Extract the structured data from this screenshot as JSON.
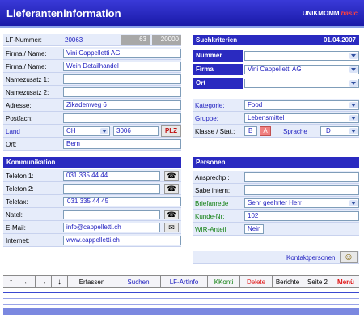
{
  "title": "Lieferanteninformation",
  "logo": {
    "main": "UNIKMOMM",
    "accent": "basic"
  },
  "left": {
    "lf_nummer_label": "LF-Nummer:",
    "lf_nummer": "20063",
    "lf_box1": "63",
    "lf_box2": "20000",
    "firma1_label": "Firma / Name:",
    "firma1": "Vini Cappelletti AG",
    "firma2_label": "Firma / Name:",
    "firma2": "Wein Detailhandel",
    "namezusatz1_label": "Namezusatz 1:",
    "namezusatz1": "",
    "namezusatz2_label": "Namezusatz 2:",
    "namezusatz2": "",
    "adresse_label": "Adresse:",
    "adresse": "Zikadenweg 6",
    "postfach_label": "Postfach:",
    "postfach": "",
    "land_label": "Land",
    "land": "CH",
    "plz": "3006",
    "plz_button": "PLZ",
    "ort_label": "Ort:",
    "ort": "Bern"
  },
  "kommunikation": {
    "header": "Kommunikation",
    "telefon1_label": "Telefon 1:",
    "telefon1": "031 335 44 44",
    "telefon2_label": "Telefon 2:",
    "telefon2": "",
    "telefax_label": "Telefax:",
    "telefax": "031 335 44 45",
    "natel_label": "Natel:",
    "natel": "",
    "email_label": "E-Mail:",
    "email": "info@cappelletti.ch",
    "internet_label": "Internet:",
    "internet": "www.cappelletti.ch"
  },
  "suchkriterien": {
    "header": "Suchkriterien",
    "date": "01.04.2007",
    "nummer_label": "Nummer",
    "nummer": "",
    "firma_label": "Firma",
    "firma": "Vini Cappelletti AG",
    "ort_label": "Ort",
    "ort": "",
    "kategorie_label": "Kategorie:",
    "kategorie": "Food",
    "gruppe_label": "Gruppe:",
    "gruppe": "Lebensmittel",
    "klasse_label": "Klasse / Stat.:",
    "klasse": "B",
    "stat": "A",
    "sprache_label": "Sprache",
    "sprache": "D"
  },
  "personen": {
    "header": "Personen",
    "ansprechp_label": "Ansprechp :",
    "ansprechp": "",
    "sabe_label": "Sabe intern:",
    "sabe": "",
    "briefanrede_label": "Briefanrede",
    "briefanrede": "Sehr geehrter Herr",
    "kunde_label": "Kunde-Nr:",
    "kunde": "102",
    "wir_label": "WIR-Anteil",
    "wir": "Nein",
    "kontakt_label": "Kontaktpersonen"
  },
  "toolbar": {
    "arrow_up": "↑",
    "arrow_left": "←",
    "arrow_right": "→",
    "arrow_down": "↓",
    "erfassen": "Erfassen",
    "suchen": "Suchen",
    "lf_artinfo": "LF-ArtInfo",
    "kkonti": "KKonti",
    "delete": "Delete",
    "berichte": "Berichte",
    "seite2": "Seite 2",
    "menu": "Menü"
  },
  "icons": {
    "phone": "☎",
    "mail": "✉",
    "smiley": "☺"
  },
  "colors": {
    "header_blue": "#2a2ac0",
    "title_blue": "#2020c0",
    "green": "#108010",
    "red": "#e01010",
    "row_bg": "#e6ecfa"
  }
}
